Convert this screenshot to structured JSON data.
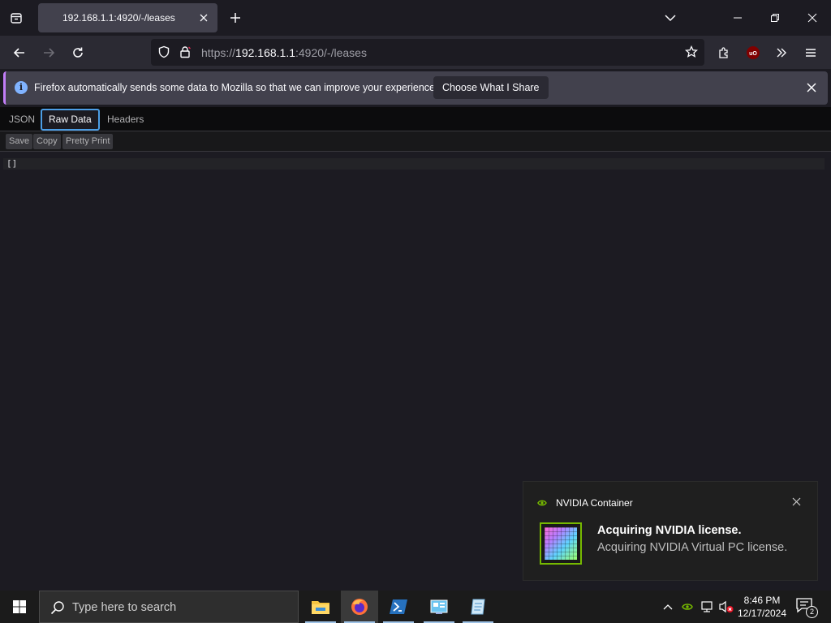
{
  "browser": {
    "tab": {
      "title": "192.168.1.1:4920/-/leases"
    },
    "url": {
      "scheme": "https://",
      "host": "192.168.1.1",
      "rest": ":4920/-/leases"
    },
    "colors": {
      "accent": "#4c9ee6",
      "notice_stripe": "#c27ef8",
      "toolbar": "#2b2a33",
      "content_bg": "#1c1b22"
    }
  },
  "notification_bar": {
    "message": "Firefox automatically sends some data to Mozilla so that we can improve your experience.",
    "button": "Choose What I Share",
    "icon": "info-icon"
  },
  "json_viewer": {
    "tabs": [
      {
        "label": "JSON",
        "selected": false
      },
      {
        "label": "Raw Data",
        "selected": true
      },
      {
        "label": "Headers",
        "selected": false
      }
    ],
    "toolbar": {
      "save": "Save",
      "copy": "Copy",
      "pretty_print": "Pretty Print"
    },
    "raw_text": "[]"
  },
  "toast": {
    "app": "NVIDIA Container",
    "title": "Acquiring NVIDIA license.",
    "body": "Acquiring NVIDIA Virtual PC license."
  },
  "taskbar": {
    "search_placeholder": "Type here to search",
    "apps": [
      "file-explorer-icon",
      "firefox-icon",
      "powershell-icon",
      "control-panel-icon",
      "notepad-icon"
    ],
    "active_app": "firefox-icon",
    "clock": {
      "time": "8:46 PM",
      "date": "12/17/2024"
    },
    "notification_count": "2"
  }
}
